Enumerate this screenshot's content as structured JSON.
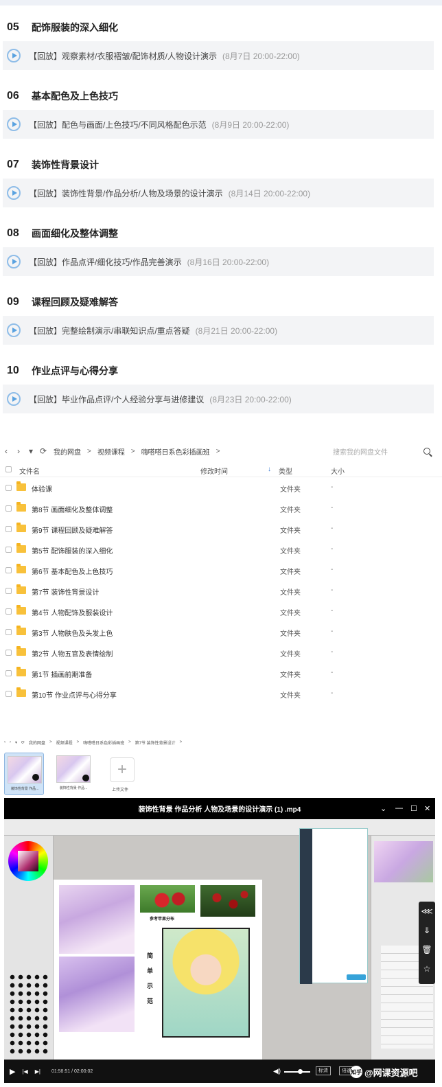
{
  "courses": [
    {
      "num": "05",
      "title": "配饰服装的深入细化",
      "item": "【回放】观察素材/衣服褶皱/配饰材质/人物设计演示",
      "date": "(8月7日 20:00-22:00)"
    },
    {
      "num": "06",
      "title": "基本配色及上色技巧",
      "item": "【回放】配色与画面/上色技巧/不同风格配色示范",
      "date": "(8月9日 20:00-22:00)"
    },
    {
      "num": "07",
      "title": "装饰性背景设计",
      "item": "【回放】装饰性背景/作品分析/人物及场景的设计演示",
      "date": "(8月14日 20:00-22:00)"
    },
    {
      "num": "08",
      "title": "画面细化及整体调整",
      "item": "【回放】作品点评/细化技巧/作品完善演示",
      "date": "(8月16日 20:00-22:00)"
    },
    {
      "num": "09",
      "title": "课程回顾及疑难解答",
      "item": "【回放】完整绘制演示/串联知识点/重点答疑",
      "date": "(8月21日 20:00-22:00)"
    },
    {
      "num": "10",
      "title": "作业点评与心得分享",
      "item": "【回放】毕业作品点评/个人经验分享与进修建议",
      "date": "(8月23日 20:00-22:00)"
    }
  ],
  "netdisk": {
    "nav_icons": {
      "back": "‹",
      "forward": "›",
      "dropdown": "▾",
      "refresh": "⟳"
    },
    "breadcrumb": [
      "我的网盘",
      "视频课程",
      "嗨嗒嗒日系色彩插画班"
    ],
    "breadcrumb_sep": ">",
    "search_placeholder": "搜索我的网盘文件",
    "columns": {
      "name": "文件名",
      "modified": "修改时间",
      "sort_arrow": "↓",
      "type": "类型",
      "size": "大小"
    },
    "rows": [
      {
        "name": "体验课",
        "type": "文件夹",
        "size": "-"
      },
      {
        "name": "第8节 画面细化及整体调整",
        "type": "文件夹",
        "size": "-"
      },
      {
        "name": "第9节 课程回顾及疑难解答",
        "type": "文件夹",
        "size": "-"
      },
      {
        "name": "第5节 配饰服装的深入细化",
        "type": "文件夹",
        "size": "-"
      },
      {
        "name": "第6节 基本配色及上色技巧",
        "type": "文件夹",
        "size": "-"
      },
      {
        "name": "第7节 装饰性背景设计",
        "type": "文件夹",
        "size": "-"
      },
      {
        "name": "第4节 人物配饰及服装设计",
        "type": "文件夹",
        "size": "-"
      },
      {
        "name": "第3节 人物肤色及头发上色",
        "type": "文件夹",
        "size": "-"
      },
      {
        "name": "第2节 人物五官及表情绘制",
        "type": "文件夹",
        "size": "-"
      },
      {
        "name": "第1节 插画前期准备",
        "type": "文件夹",
        "size": "-"
      },
      {
        "name": "第10节 作业点评与心得分享",
        "type": "文件夹",
        "size": "-"
      }
    ]
  },
  "mini": {
    "breadcrumb": [
      "我的网盘",
      "视频课程",
      "嗨嗒嗒日系色彩插画班",
      "第7节 装饰性背景设计"
    ],
    "files": [
      "装饰性背景 作品...",
      "装饰性背景 作品..."
    ],
    "upload_label": "上传文件",
    "upload_icon": "+"
  },
  "player": {
    "title": "装饰性背景 作品分析 人物及场景的设计演示 (1) .mp4",
    "window_controls": [
      "⌄",
      "—",
      "☐",
      "✕"
    ],
    "ref_label": "参考苹果分布",
    "vertical_text": [
      "简",
      "单",
      "示",
      "范"
    ],
    "side_icons": [
      "share-icon",
      "download-icon",
      "delete-icon",
      "pin-icon"
    ],
    "side_glyphs": [
      "⋘",
      "⇓",
      "🗑",
      "☆"
    ],
    "play_glyph": "▶",
    "prev_glyph": "|◀",
    "next_glyph": "▶|",
    "time_current": "01:58:51",
    "time_total": "02:00:02",
    "volume_glyph": "◀)",
    "tags": [
      "标清",
      "倍速"
    ],
    "watermark": "@网课资源吧",
    "watermark_icon": "知乎"
  }
}
